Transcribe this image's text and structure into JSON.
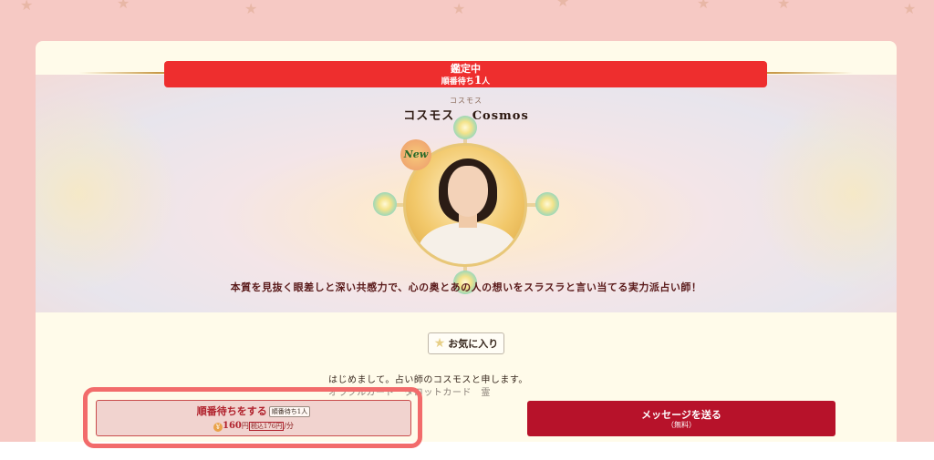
{
  "status": {
    "title": "鑑定中",
    "queue_prefix": "順番待ち",
    "queue_count": "1",
    "queue_suffix": "人"
  },
  "fortune_teller": {
    "reading": "コスモス",
    "name": "コスモス ＿Cosmos",
    "badge": "New",
    "catchphrase": "本質を見抜く眼差しと深い共感力で、心の奥とあの人の想いをスラスラと言い当てる実力派占い師！"
  },
  "favorite": {
    "label": "お気に入り",
    "icon": "star-icon"
  },
  "intro": {
    "line1": "はじめまして。占い師のコスモスと申します。",
    "line2": "オラクルカード　タロットカード　霊"
  },
  "actions": {
    "queue_label": "順番待ちをする",
    "queue_tag": "順番待ち1人",
    "price_coin": "¥",
    "price": "160",
    "price_unit": "円",
    "tax_included": "税込176円",
    "per_minute": "/分",
    "message_label": "メッセージを送る",
    "message_sub": "（無料）"
  },
  "colors": {
    "background_pink": "#f6c9c4",
    "status_red": "#ee2e2e",
    "message_button": "#b7122a",
    "highlight": "#f26b6b"
  }
}
